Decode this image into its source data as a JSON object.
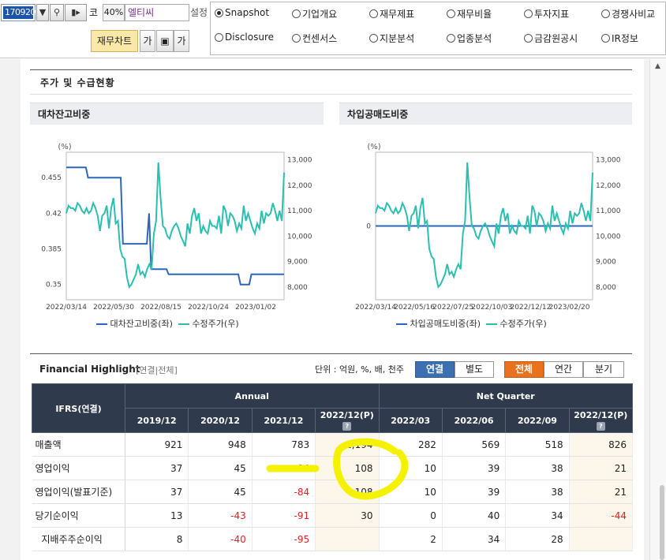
{
  "toolbar": {
    "code_value": "170920",
    "code_label": "코",
    "zoom": "40%",
    "company": "엘티씨",
    "setting_label": "설정",
    "fin_chart_button": "재무차트",
    "font_bigger": "가",
    "font_smaller": "가"
  },
  "radio_tabs": [
    {
      "label": "Snapshot",
      "selected": true
    },
    {
      "label": "기업개요",
      "selected": false
    },
    {
      "label": "재무제표",
      "selected": false
    },
    {
      "label": "재무비율",
      "selected": false
    },
    {
      "label": "투자지표",
      "selected": false
    },
    {
      "label": "경쟁사비교",
      "selected": false
    },
    {
      "label": "Disclosure",
      "selected": false
    },
    {
      "label": "컨센서스",
      "selected": false
    },
    {
      "label": "지분분석",
      "selected": false
    },
    {
      "label": "업종분석",
      "selected": false
    },
    {
      "label": "금감원공시",
      "selected": false
    },
    {
      "label": "IR정보",
      "selected": false
    }
  ],
  "section_title": "주가 및 수급현황",
  "chart_data": [
    {
      "type": "line",
      "title": "대차잔고비중",
      "unit_label": "(%)",
      "x_ticks": [
        "2022/03/14",
        "2022/05/30",
        "2022/08/15",
        "2022/10/24",
        "2023/01/02"
      ],
      "y_left_ticks": [
        "0.455",
        "0.42",
        "0.385",
        "0.35"
      ],
      "y_left_range": [
        0.335,
        0.48
      ],
      "y_right_ticks": [
        "13,000",
        "12,000",
        "11,000",
        "10,000",
        "9,000",
        "8,000"
      ],
      "y_right_range": [
        7500,
        13300
      ],
      "series": [
        {
          "name": "대차잔고비중(좌)",
          "axis": "left",
          "color": "#2e67b8",
          "values": [
            0.465,
            0.465,
            0.465,
            0.465,
            0.465,
            0.465,
            0.465,
            0.465,
            0.465,
            0.465,
            0.455,
            0.455,
            0.455,
            0.455,
            0.455,
            0.455,
            0.455,
            0.455,
            0.455,
            0.455,
            0.455,
            0.455,
            0.455,
            0.455,
            0.455,
            0.455,
            0.39,
            0.39,
            0.39,
            0.39,
            0.39,
            0.39,
            0.39,
            0.39,
            0.39,
            0.39,
            0.39,
            0.39,
            0.42,
            0.365,
            0.365,
            0.365,
            0.365,
            0.365,
            0.365,
            0.365,
            0.365,
            0.36,
            0.36,
            0.36,
            0.36,
            0.36,
            0.36,
            0.36,
            0.36,
            0.36,
            0.36,
            0.36,
            0.36,
            0.36,
            0.36,
            0.36,
            0.36,
            0.36,
            0.36,
            0.36,
            0.36,
            0.36,
            0.36,
            0.36,
            0.36,
            0.36,
            0.36,
            0.36,
            0.36,
            0.36,
            0.36,
            0.36,
            0.36,
            0.36,
            0.35,
            0.35,
            0.35,
            0.35,
            0.35,
            0.36,
            0.36,
            0.36,
            0.36,
            0.36,
            0.36,
            0.36,
            0.36,
            0.36,
            0.36,
            0.36,
            0.36,
            0.36,
            0.36,
            0.36,
            0.36
          ]
        },
        {
          "name": "수정주가(우)",
          "axis": "right",
          "color": "#2bbfb0",
          "values": [
            10900,
            11200,
            11100,
            11100,
            11000,
            11300,
            11200,
            11000,
            10900,
            11100,
            10900,
            11000,
            11300,
            11100,
            10800,
            10200,
            10800,
            10900,
            11200,
            10300,
            11100,
            11500,
            10500,
            10600,
            9500,
            9200,
            9100,
            8400,
            8000,
            8100,
            8300,
            8500,
            8900,
            8500,
            8600,
            8400,
            8700,
            8900,
            8700,
            10100,
            10600,
            12900,
            11500,
            10400,
            10300,
            10000,
            9900,
            10200,
            10400,
            10500,
            10300,
            10000,
            9800,
            9600,
            10500,
            10100,
            10800,
            11100,
            10600,
            10900,
            10100,
            10400,
            10200,
            10100,
            10600,
            10400,
            10400,
            10300,
            10800,
            10100,
            11200,
            11000,
            10400,
            10900,
            10800,
            10600,
            10200,
            10500,
            10300,
            11200,
            10600,
            10900,
            10600,
            10300,
            10100,
            10500,
            10300,
            11000,
            10500,
            10900,
            10800,
            10900,
            11300,
            11000,
            10600,
            11000,
            10600,
            12500
          ]
        }
      ],
      "legend_position": "bottom"
    },
    {
      "type": "line",
      "title": "차입공매도비중",
      "unit_label": "(%)",
      "x_ticks": [
        "2022/03/14",
        "2022/05/16",
        "2022/07/25",
        "2022/10/03",
        "2022/12/12",
        "2023/02/20"
      ],
      "y_left_ticks": [
        "0"
      ],
      "y_left_range": [
        -1,
        1
      ],
      "y_right_ticks": [
        "13,000",
        "12,000",
        "11,000",
        "10,000",
        "9,000",
        "8,000"
      ],
      "y_right_range": [
        7500,
        13300
      ],
      "series": [
        {
          "name": "차입공매도비중(좌)",
          "axis": "left",
          "color": "#2e67b8",
          "values": [
            0,
            0,
            0,
            0,
            0,
            0,
            0,
            0,
            0,
            0,
            0,
            0,
            0,
            0,
            0,
            0,
            0,
            0,
            0,
            0,
            0,
            0,
            0,
            0,
            0,
            0,
            0,
            0,
            0,
            0,
            0,
            0,
            0,
            0,
            0,
            0,
            0,
            0,
            0,
            0,
            0,
            0,
            0,
            0,
            0,
            0,
            0,
            0,
            0,
            0,
            0,
            0,
            0,
            0,
            0,
            0,
            0,
            0,
            0,
            0,
            0,
            0,
            0,
            0,
            0,
            0,
            0,
            0,
            0,
            0,
            0,
            0,
            0,
            0,
            0,
            0,
            0,
            0,
            0,
            0,
            0,
            0,
            0,
            0,
            0,
            0,
            0,
            0,
            0,
            0,
            0,
            0,
            0,
            0,
            0,
            0,
            0,
            0,
            0,
            0,
            0
          ]
        },
        {
          "name": "수정주가(우)",
          "axis": "right",
          "color": "#2bbfb0",
          "values": [
            10900,
            11200,
            11100,
            11100,
            11000,
            11300,
            11200,
            11000,
            10900,
            11100,
            10900,
            11000,
            11300,
            11100,
            10800,
            10200,
            10800,
            10900,
            11200,
            10300,
            11100,
            11500,
            10500,
            10600,
            9500,
            9200,
            9100,
            8400,
            8000,
            8100,
            8300,
            8500,
            8900,
            8500,
            8600,
            8400,
            8700,
            8900,
            8700,
            10100,
            10600,
            12900,
            11500,
            10400,
            10300,
            10000,
            9900,
            10200,
            10400,
            10500,
            10300,
            10000,
            9800,
            9600,
            10500,
            10100,
            10800,
            11100,
            10600,
            10900,
            10100,
            10400,
            10200,
            10100,
            10600,
            10400,
            10400,
            10300,
            10800,
            10100,
            11200,
            11000,
            10400,
            10900,
            10800,
            10600,
            10200,
            10500,
            10300,
            11200,
            10600,
            10900,
            10600,
            10300,
            10100,
            10500,
            10300,
            11000,
            10500,
            10900,
            10800,
            10900,
            11300,
            11000,
            10600,
            11000,
            10600,
            12500
          ]
        }
      ],
      "legend_position": "bottom"
    }
  ],
  "financial": {
    "title": "Financial Highlight",
    "subtitle": "[연결|전체]",
    "unit_text": "단위 : 억원, %, 배, 천주",
    "basis_toggle": [
      "연결",
      "별도"
    ],
    "basis_selected": "연결",
    "period_toggle": [
      "전체",
      "연간",
      "분기"
    ],
    "period_selected": "전체",
    "corner_header": "IFRS(연결)",
    "group_headers": [
      "Annual",
      "Net Quarter"
    ],
    "columns": [
      "2019/12",
      "2020/12",
      "2021/12",
      "2022/12(P)",
      "2022/03",
      "2022/06",
      "2022/09",
      "2022/12(P)"
    ],
    "estimate_column_indexes": [
      3,
      7
    ],
    "rows": [
      {
        "label": "매출액",
        "values": [
          "921",
          "948",
          "783",
          "2,194",
          "282",
          "569",
          "518",
          "826"
        ]
      },
      {
        "label": "영업이익",
        "values": [
          "37",
          "45",
          "-84",
          "108",
          "10",
          "39",
          "38",
          "21"
        ]
      },
      {
        "label": "영업이익(발표기준)",
        "values": [
          "37",
          "45",
          "-84",
          "108",
          "10",
          "39",
          "38",
          "21"
        ]
      },
      {
        "label": "당기순이익",
        "values": [
          "13",
          "-43",
          "-91",
          "30",
          "0",
          "40",
          "34",
          "-44"
        ]
      },
      {
        "label": "지배주주순이익",
        "values": [
          "8",
          "-40",
          "-95",
          "",
          "2",
          "34",
          "28",
          ""
        ]
      }
    ],
    "highlight_color": "#f5f200",
    "negative_color": "#e02020"
  }
}
